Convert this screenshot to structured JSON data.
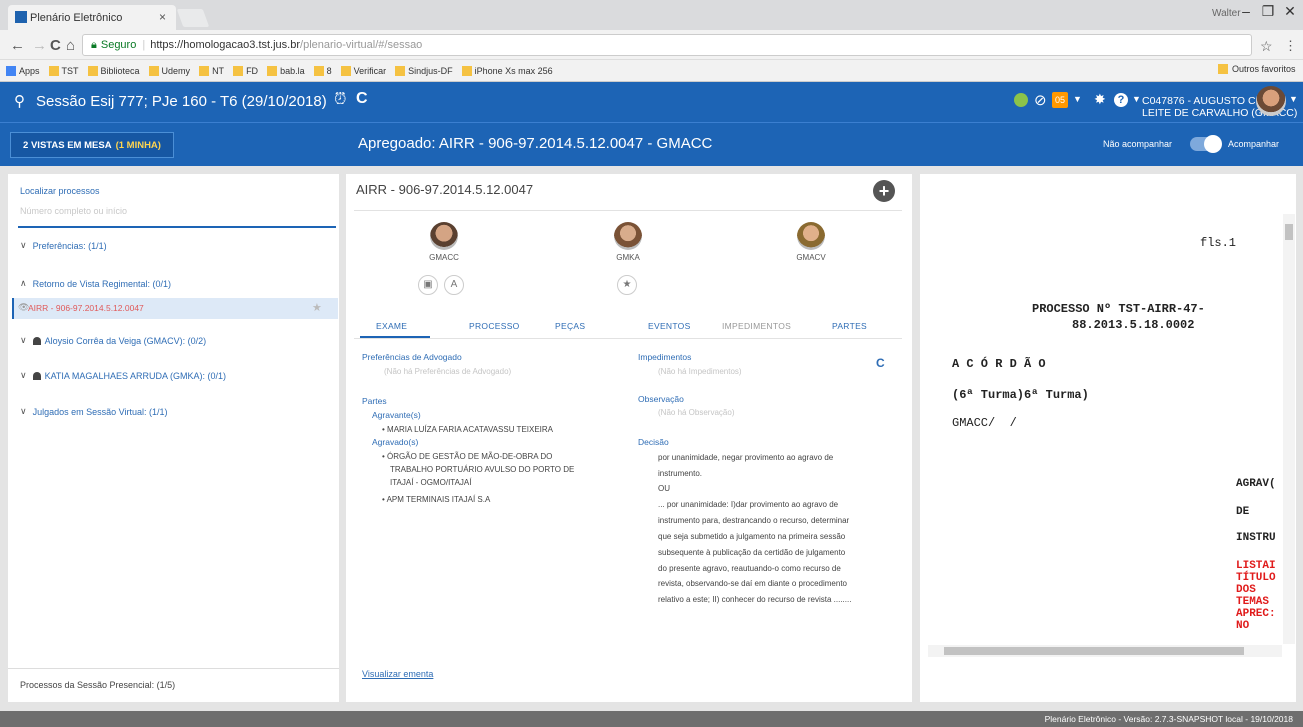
{
  "browser": {
    "tab_title": "Plenário Eletrônico",
    "tab_close": "×",
    "window_user": "Walter",
    "win_min": "–",
    "win_max": "❐",
    "win_close": "✕",
    "secure_label": "Seguro",
    "url_host": "https://homologacao3.tst.jus.br",
    "url_path": "/plenario-virtual/#/sessao",
    "bookmarks": [
      "Apps",
      "TST",
      "Biblioteca",
      "Udemy",
      "NT",
      "FD",
      "bab.la",
      "8",
      "Verificar",
      "Sindjus-DF",
      "iPhone Xs max 256"
    ],
    "other_bookmarks": "Outros favoritos"
  },
  "header": {
    "session_title": "Sessão Esij 777; PJe 160 - T6 (29/10/2018)",
    "badge": "05",
    "user": "C047876 - AUGUSTO CÉSAR LEITE DE CARVALHO (GMACC)"
  },
  "subheader": {
    "vistas": "2 VISTAS EM MESA",
    "vistas_mine": "(1 MINHA)",
    "apregoado": "Apregoado: AIRR - 906-97.2014.5.12.0047 - GMACC",
    "nao_acompanhar": "Não acompanhar",
    "acompanhar": "Acompanhar"
  },
  "left": {
    "localizar": "Localizar processos",
    "placeholder": "Número completo ou início",
    "groups": [
      "Preferências: (1/1)",
      "Retorno de Vista Regimental: (0/1)",
      "Aloysio Corrêa da Veiga (GMACV): (0/2)",
      "KATIA MAGALHAES ARRUDA (GMKA): (0/1)",
      "Julgados em Sessão Virtual: (1/1)"
    ],
    "selected_item": "AIRR - 906-97.2014.5.12.0047",
    "presencial": "Processos da Sessão Presencial: (1/5)"
  },
  "center": {
    "process_number": "AIRR - 906-97.2014.5.12.0047",
    "members": [
      "GMACC",
      "GMKA",
      "GMACV"
    ],
    "tabs": [
      "EXAME",
      "PROCESSO",
      "PEÇAS",
      "EVENTOS",
      "IMPEDIMENTOS",
      "PARTES"
    ],
    "pref_title": "Preferências de Advogado",
    "pref_empty": "(Não há Preferências de Advogado)",
    "partes_title": "Partes",
    "agravante_title": "Agravante(s)",
    "agravante": "MARIA LUÍZA FARIA ACATAVASSU TEIXEIRA",
    "agravado_title": "Agravado(s)",
    "agravado_1_l1": "ÓRGÃO DE GESTÃO DE MÃO-DE-OBRA DO",
    "agravado_1_l2": "TRABALHO PORTUÁRIO AVULSO DO PORTO DE",
    "agravado_1_l3": "ITAJAÍ - OGMO/ITAJAÍ",
    "agravado_2": "APM TERMINAIS ITAJAÍ S.A",
    "imped_title": "Impedimentos",
    "imped_empty": "(Não há Impedimentos)",
    "obs_title": "Observação",
    "obs_empty": "(Não há Observação)",
    "dec_title": "Decisão",
    "dec_lines": [
      "por unanimidade, negar provimento ao agravo de",
      "instrumento.",
      "OU",
      "... por unanimidade: I)dar provimento ao agravo de",
      "instrumento para, destrancando o recurso, determinar",
      "que seja submetido a julgamento na primeira sessão",
      "subsequente à publicação da certidão de julgamento",
      "do presente agravo, reautuando-o como recurso de",
      "revista, observando-se daí em diante o procedimento",
      "relativo a este; II) conhecer do recurso de revista ........"
    ],
    "ementa": "Visualizar ementa"
  },
  "doc": {
    "fls": "fls.1",
    "processo_l1": "PROCESSO Nº TST-AIRR-47-",
    "processo_l2": "88.2013.5.18.0002",
    "acordao": "A C Ó R D Ã O",
    "turma": "(6ª Turma)6ª Turma)",
    "gmacc": "GMACC/  /",
    "agrav": "AGRAV(",
    "de": "DE",
    "instru": "INSTRU",
    "red_lines": [
      "LISTAI",
      "TÍTULO",
      "DOS",
      "TEMAS",
      "APREC:",
      "NO"
    ]
  },
  "footer": "Plenário Eletrônico - Versão: 2.7.3-SNAPSHOT local - 19/10/2018",
  "colors": {
    "brand": "#1d64b5",
    "link": "#2f6db5",
    "alert": "#e01b1b",
    "badge": "#ff9800"
  }
}
